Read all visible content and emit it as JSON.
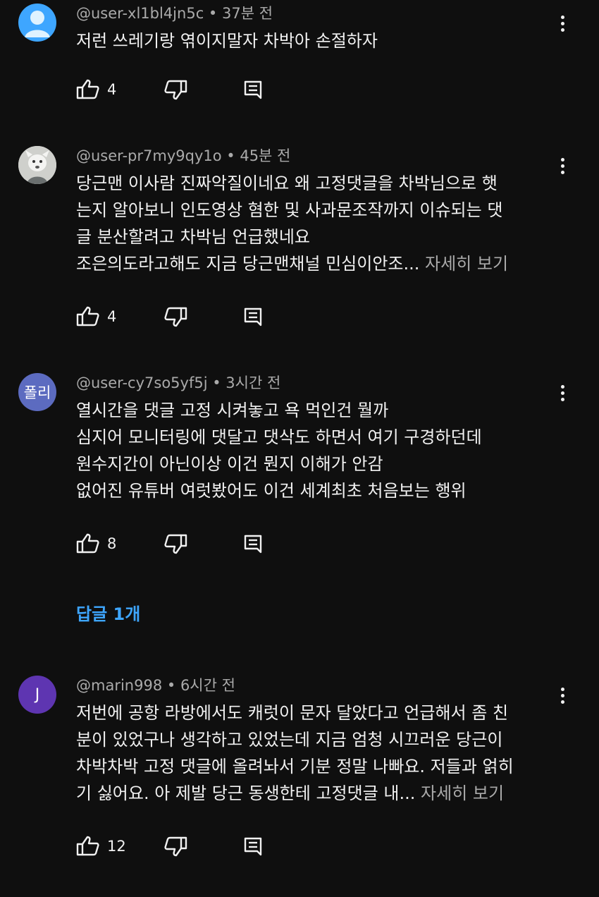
{
  "comments": [
    {
      "username": "@user-xl1bl4jn5c",
      "time": "37분 전",
      "avatar_label": "",
      "avatar_color": "#3ea6ff",
      "lines": [
        "저런 쓰레기랑 엮이지말자 차박아 손절하자"
      ],
      "more_line": "",
      "more_label": "",
      "likes": "4"
    },
    {
      "username": "@user-pr7my9qy1o",
      "time": "45분 전",
      "avatar_label": "",
      "avatar_color": "#d9d9d6",
      "lines": [
        "당근맨 이사람  진짜악질이네요 왜 고정댓글을 차박님으로 햇",
        "는지 알아보니 인도영상 혐한 및 사과문조작까지 이슈되는 댓",
        "글 분산할려고 차박님 언급했네요"
      ],
      "more_line": "조은의도라고해도 지금 당근맨채널 민심이안조...",
      "more_label": "자세히 보기",
      "likes": "4"
    },
    {
      "username": "@user-cy7so5yf5j",
      "time": "3시간 전",
      "avatar_label": "폴리",
      "avatar_color": "#5c6bc0",
      "lines": [
        "열시간을 댓글 고정 시켜놓고 욕 먹인건 뭘까",
        "심지어 모니터링에 댓달고 댓삭도 하면서 여기 구경하던데",
        "원수지간이 아닌이상 이건 뭔지 이해가 안감",
        "없어진 유튜버 여럿봤어도 이건 세계최초 처음보는 행위"
      ],
      "more_line": "",
      "more_label": "",
      "likes": "8",
      "replies": "답글 1개"
    },
    {
      "username": "@marin998",
      "time": "6시간 전",
      "avatar_label": "J",
      "avatar_color": "#5e35b1",
      "lines": [
        "저번에 공항 라방에서도 캐럿이 문자 달았다고 언급해서 좀 친",
        "분이 있었구나 생각하고 있었는데 지금 엄청 시끄러운 당근이",
        "차박차박 고정 댓글에 올려놔서 기분 정말 나빠요. 저들과 얽히"
      ],
      "more_line": "기 싫어요. 아 제발 당근 동생한테 고정댓글 내...",
      "more_label": "자세히 보기",
      "likes": "12"
    }
  ]
}
